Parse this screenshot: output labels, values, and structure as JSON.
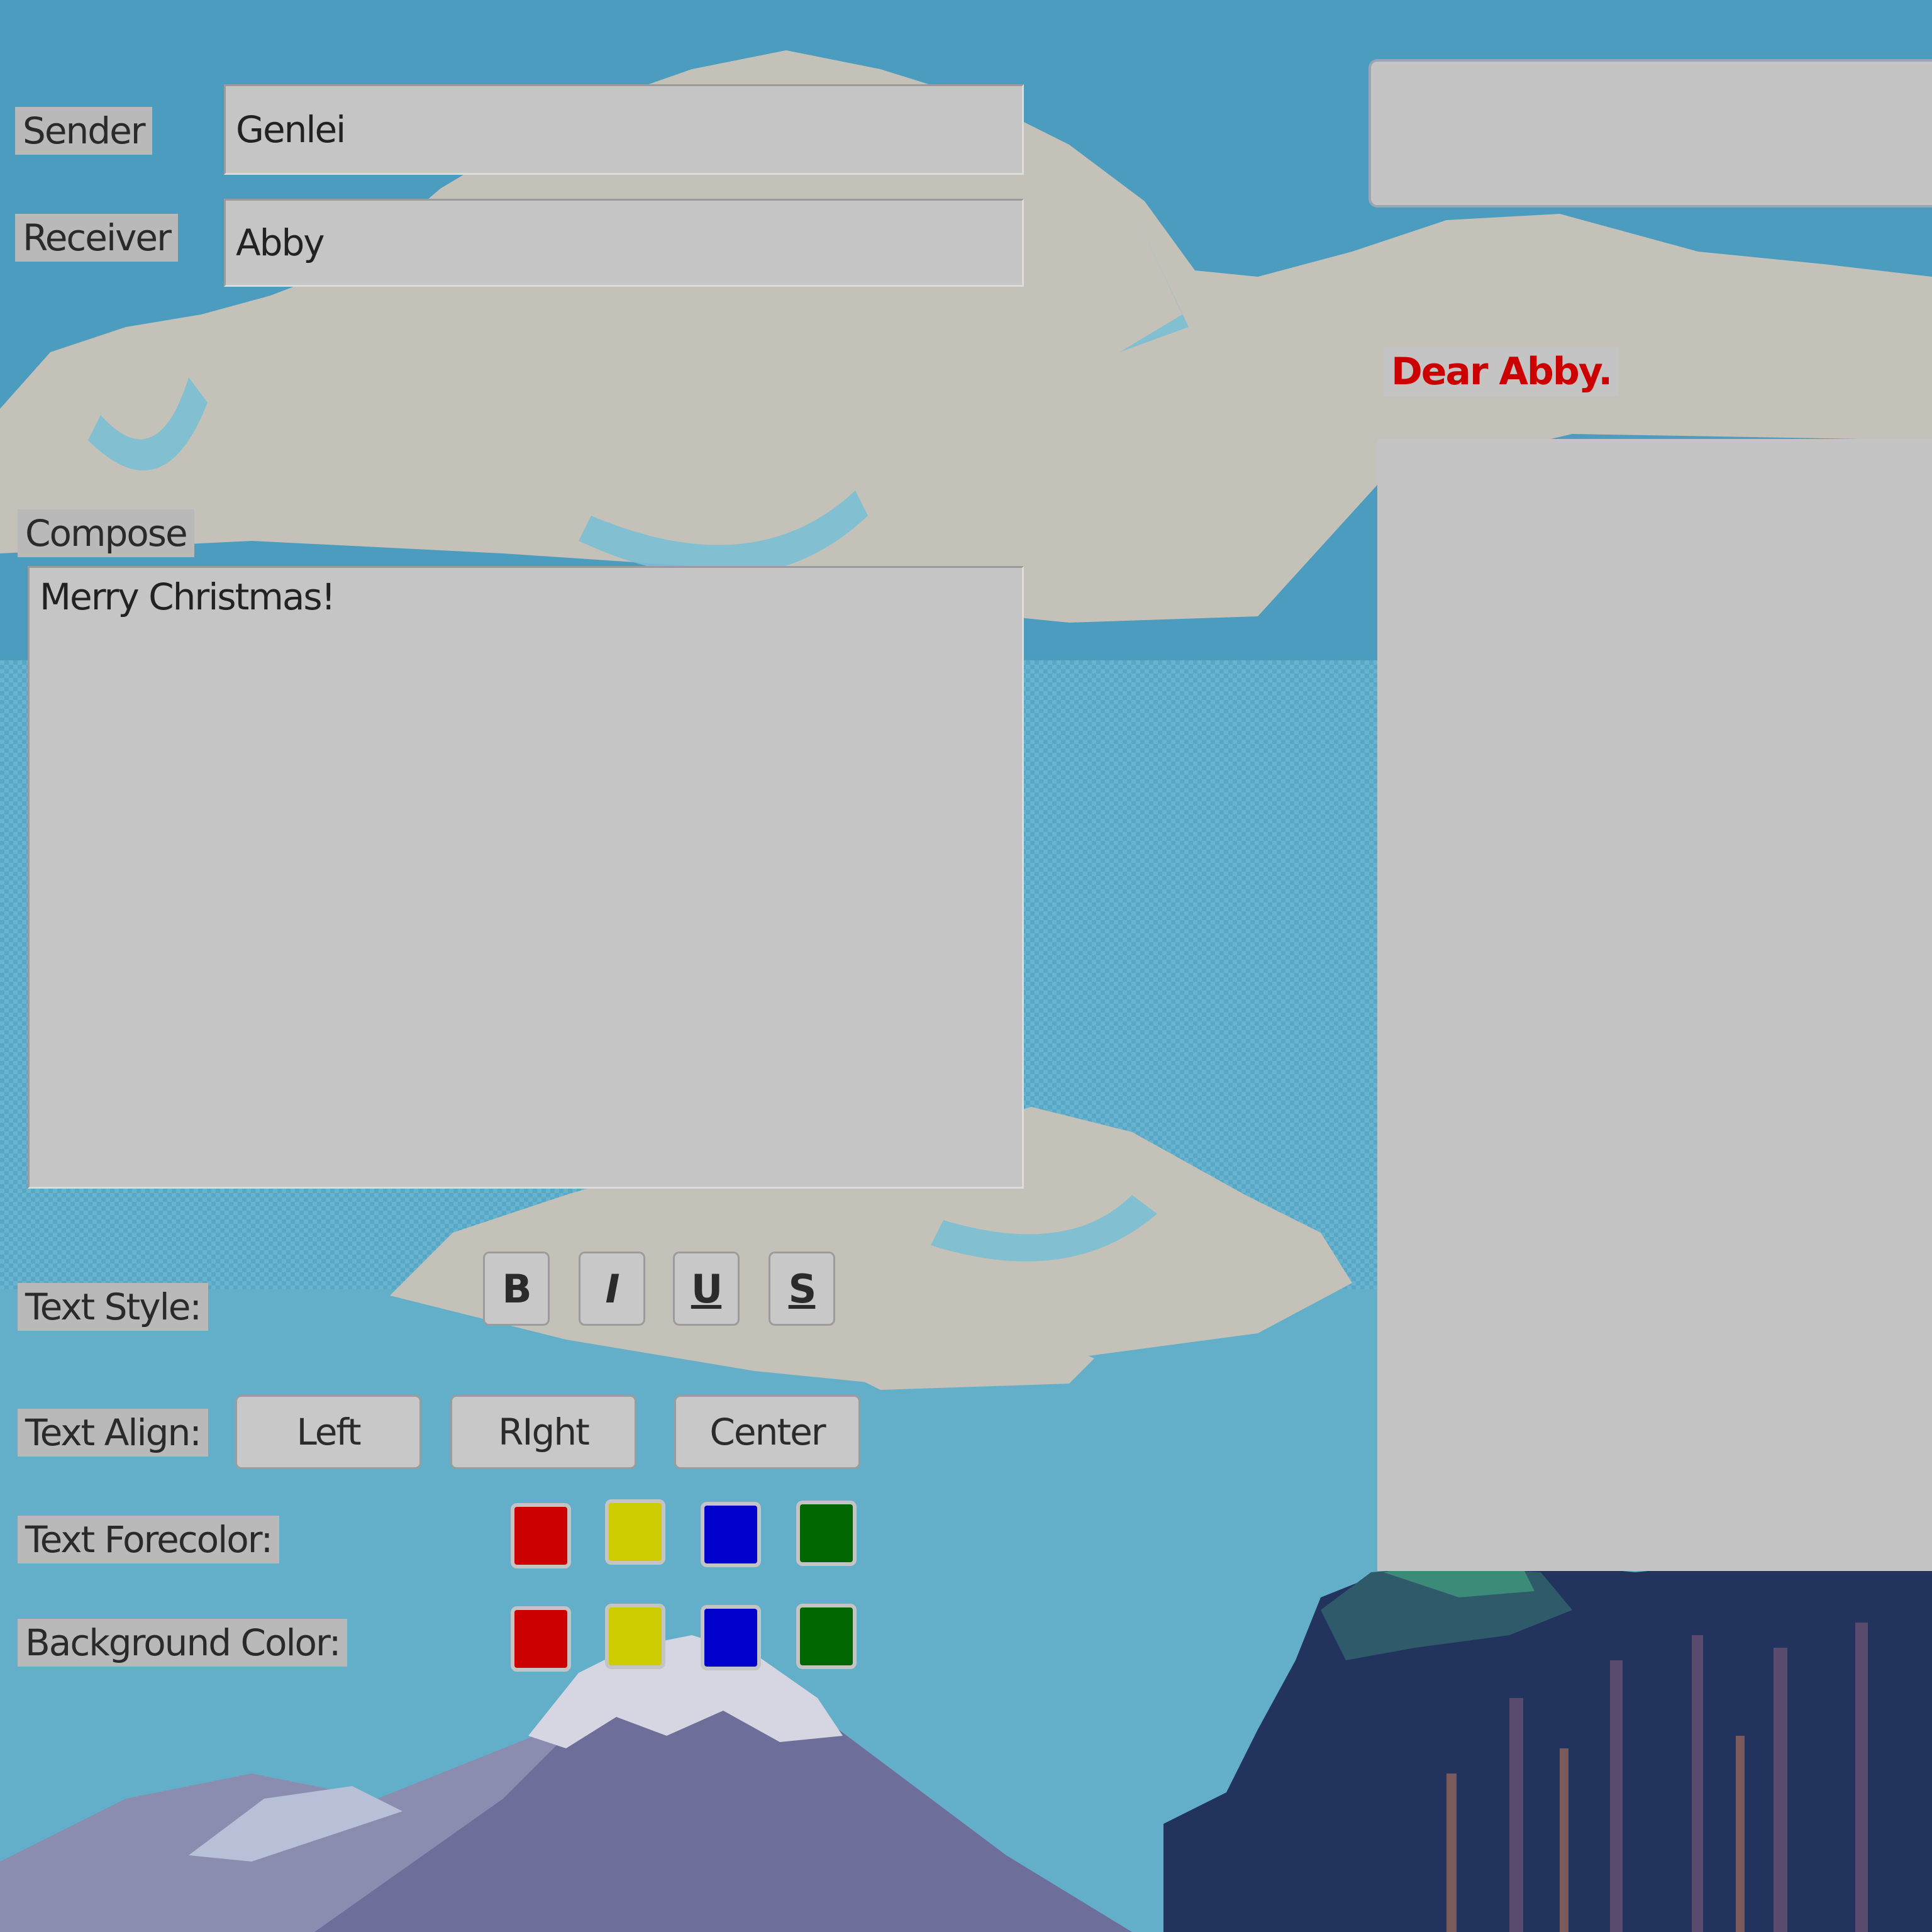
{
  "form": {
    "sender_label": "Sender",
    "sender_value": "Genlei",
    "receiver_label": "Receiver",
    "receiver_value": "Abby",
    "compose_label": "Compose",
    "compose_value": "Merry Christmas!"
  },
  "text_style": {
    "label": "Text Style:",
    "bold": "B",
    "italic": "I",
    "underline": "U",
    "strike": "S"
  },
  "text_align": {
    "label": "Text Align:",
    "left": "Left",
    "right": "RIght",
    "center": "Center"
  },
  "forecolor": {
    "label": "Text Forecolor:",
    "swatches": [
      "#cc0000",
      "#cccc00",
      "#0000cc",
      "#006600"
    ]
  },
  "backcolor": {
    "label": "Background Color:",
    "swatches": [
      "#cc0000",
      "#cccc00",
      "#0000cc",
      "#006600"
    ]
  },
  "preview": {
    "greeting": "Dear Abby.",
    "greeting_color": "#cc0000"
  },
  "scene_colors": {
    "sky": "#4fa3c4",
    "cloud": "#c4c2b8",
    "mountain": "#6e6e9a",
    "tree_dark": "#22345e"
  }
}
